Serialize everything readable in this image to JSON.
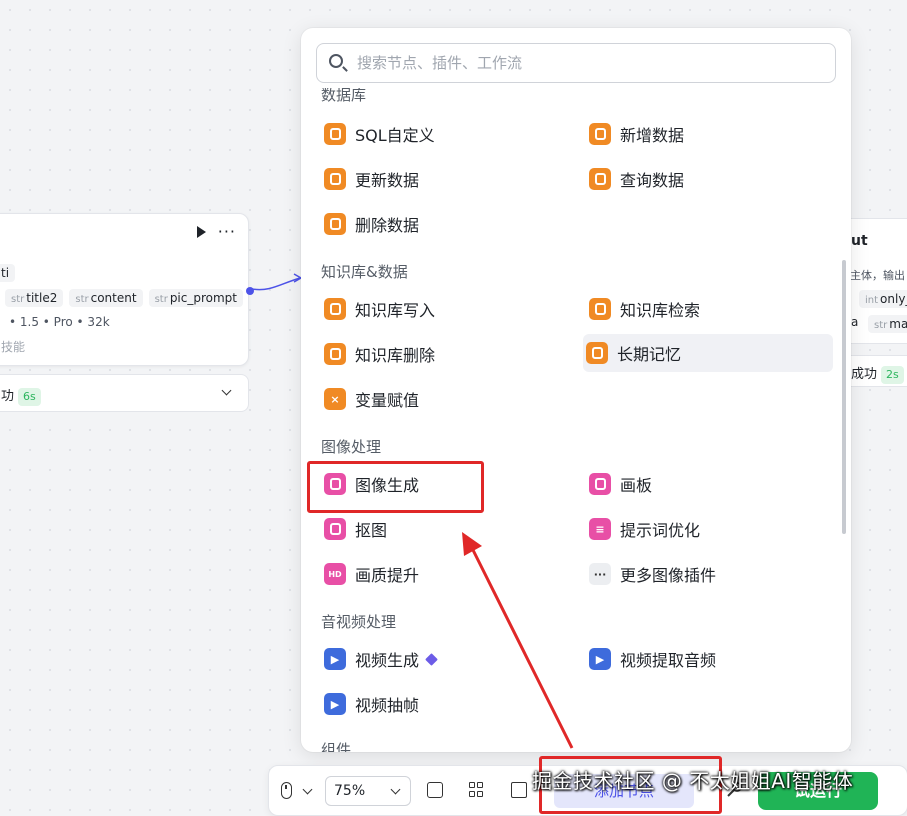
{
  "left_node": {
    "chip_fragment": "ti",
    "vars": [
      {
        "type": "str",
        "name": "title2"
      },
      {
        "type": "str",
        "name": "content"
      },
      {
        "type": "str",
        "name": "pic_prompt"
      }
    ],
    "meta": "• 1.5 • Pro • 32k",
    "skill": "技能",
    "status": "功",
    "duration": "6s"
  },
  "right_node": {
    "title": "ut",
    "desc": "主体，输出",
    "var1": {
      "type": "int",
      "name": "only_"
    },
    "var2_prefix": "a",
    "var3": {
      "type": "str",
      "name": "mas"
    },
    "status": "成功",
    "duration": "2s"
  },
  "panel": {
    "search_placeholder": "搜索节点、插件、工作流",
    "sections": {
      "database": "数据库",
      "knowledge": "知识库&数据",
      "image": "图像处理",
      "av": "音视频处理",
      "component": "组件"
    },
    "items": {
      "sql": "SQL自定义",
      "add_data": "新增数据",
      "update_data": "更新数据",
      "query_data": "查询数据",
      "delete_data": "删除数据",
      "kb_write": "知识库写入",
      "kb_search": "知识库检索",
      "kb_delete": "知识库删除",
      "long_memory": "长期记忆",
      "var_assign": "变量赋值",
      "image_gen": "图像生成",
      "canvas": "画板",
      "cutout": "抠图",
      "prompt_opt": "提示词优化",
      "quality_up": "画质提升",
      "more_image": "更多图像插件",
      "video_gen": "视频生成",
      "video_audio": "视频提取音频",
      "video_frames": "视频抽帧"
    },
    "icons": {
      "hd_badge": "HD",
      "more": "···"
    }
  },
  "toolbar": {
    "zoom": "75%",
    "add_node": "添加节点",
    "run": "试运行"
  },
  "watermark": "掘金技术社区 @ 不太姐姐AI智能体",
  "colors": {
    "accent": "#4d53e8",
    "database_icon": "#f08a24",
    "image_icon": "#e84fa6",
    "video_icon": "#3e6bdc",
    "run_button": "#20b456",
    "highlight_box": "#e02828"
  }
}
